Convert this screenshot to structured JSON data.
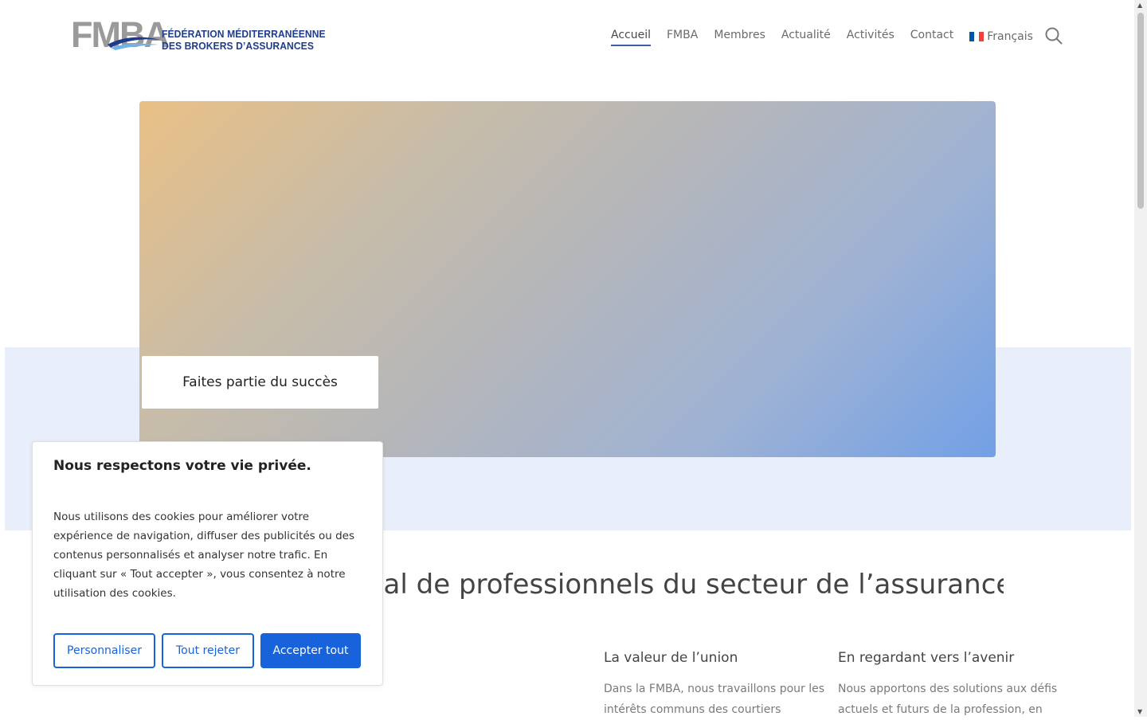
{
  "header": {
    "logo": {
      "wordmark": "FMBA",
      "line1": "FÉDÉRATION MÉDITERRANÉENNE",
      "line2": "DES BROKERS D’ASSURANCES"
    },
    "nav": [
      {
        "label": "Accueil",
        "active": true
      },
      {
        "label": "FMBA"
      },
      {
        "label": "Membres"
      },
      {
        "label": "Actualité"
      },
      {
        "label": "Activités"
      },
      {
        "label": "Contact"
      }
    ],
    "language": {
      "label": "Français",
      "flag_colors": [
        "#0055a4",
        "#ffffff",
        "#ef4135"
      ]
    },
    "search_icon": "search-icon"
  },
  "hero": {
    "cta_label": "Faites partie du succès",
    "gradient_colors": [
      "#e9c085",
      "#72a0e6"
    ]
  },
  "section": {
    "heading": "nal de professionnels du secteur de l’assurance",
    "columns": [
      {
        "title": "La valeur de l’union",
        "text": "Dans la FMBA, nous travaillons pour les intérêts communs des courtiers"
      },
      {
        "title": "En regardant vers l’avenir",
        "text": "Nous apportons des solutions aux défis actuels et futurs de la profession, en"
      }
    ]
  },
  "cookie": {
    "title": "Nous respectons votre vie privée.",
    "text": "Nous utilisons des cookies pour améliorer votre expérience de navigation, diffuser des publicités ou des contenus personnalisés et analyser notre trafic. En cliquant sur « Tout accepter », vous consentez à notre utilisation des cookies.",
    "buttons": {
      "customize": "Personnaliser",
      "reject": "Tout rejeter",
      "accept": "Accepter tout"
    },
    "accent_color": "#1863dc"
  }
}
